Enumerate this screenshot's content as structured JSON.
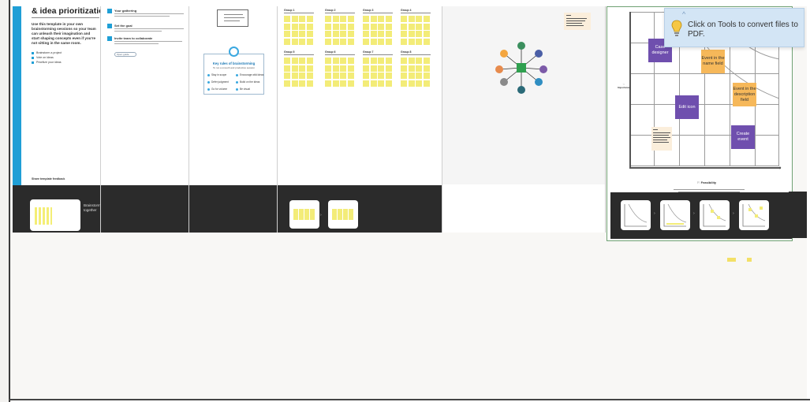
{
  "app": {
    "accent": "#1f9fd6",
    "sticky": "#f3ec78",
    "purple": "#6f4fae",
    "orange": "#f6b85a"
  },
  "board1": {
    "title": "& idea prioritization",
    "intro": "Use this template in your own brainstorming sessions so your team can unleash their imagination and start shaping concepts even if you're not sitting in the same room.",
    "bullets": [
      "Brainstorm a project",
      "Vote on ideas",
      "Prioritize your ideas"
    ],
    "link": "Share template feedback",
    "thumb_title": "Brainstorm together",
    "thumb_button": "Open template"
  },
  "board2": {
    "steps": [
      "Your gathering",
      "Set the goal",
      "Invite team to collaborate"
    ],
    "pill": "Open guide"
  },
  "board3": {
    "card_title": "Key rules of brainstorming",
    "card_sub": "To run a smooth and productive session",
    "tips": [
      "Stay in scope",
      "Defer judgment",
      "Go for volume",
      "Encourage wild ideas",
      "Build on the ideas",
      "Be visual"
    ]
  },
  "board4": {
    "groups": [
      "Group 1",
      "Group 2",
      "Group 3",
      "Group 4",
      "Group 5",
      "Group 6",
      "Group 7",
      "Group 8"
    ]
  },
  "board6": {
    "cards": [
      "Case designer",
      "Event in the name field",
      "Edit icon",
      "Event in the description field",
      "Create event"
    ],
    "importance_label": "Importance",
    "feasibility_label": "Feasibility"
  },
  "tooltip": {
    "message": "Click on Tools to convert files to PDF."
  }
}
